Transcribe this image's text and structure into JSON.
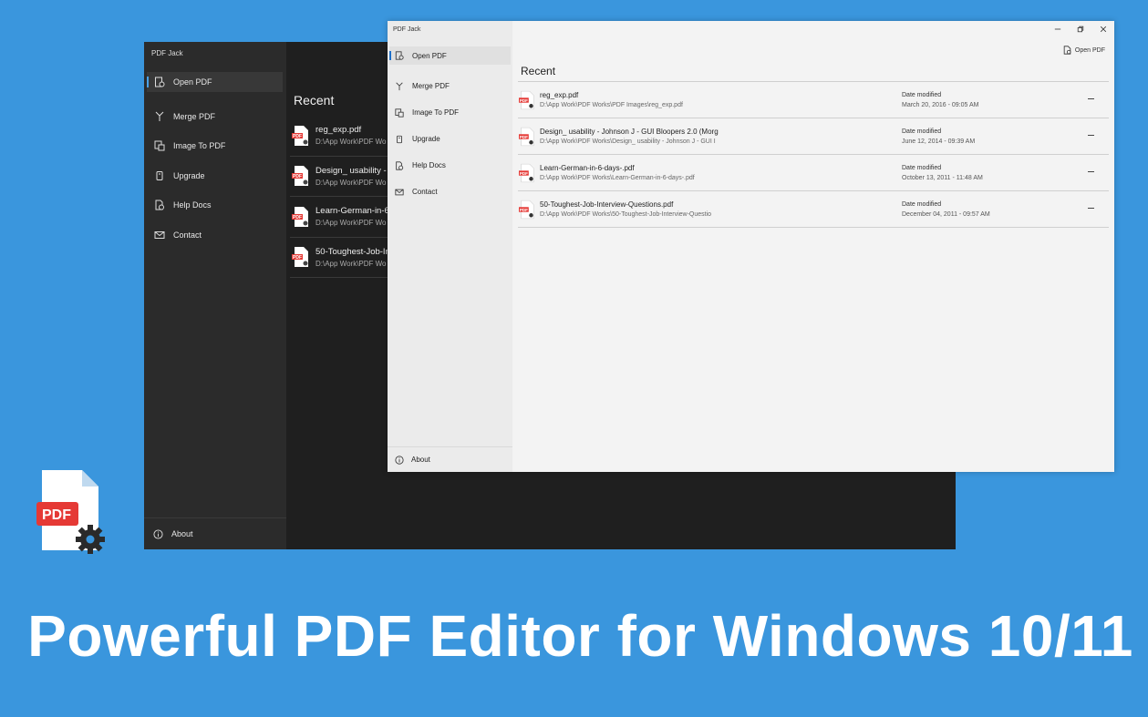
{
  "headline": "Powerful PDF Editor for Windows 10/11",
  "colors": {
    "background": "#3a96dd",
    "accent": "#1d6fc9",
    "pdf_red": "#e53935"
  },
  "dark_window": {
    "title": "PDF Jack",
    "nav": [
      {
        "label": "Open PDF",
        "icon": "open-pdf-icon"
      },
      {
        "label": "Merge PDF",
        "icon": "merge-icon"
      },
      {
        "label": "Image To PDF",
        "icon": "image-icon"
      },
      {
        "label": "Upgrade",
        "icon": "upgrade-icon"
      },
      {
        "label": "Help Docs",
        "icon": "help-docs-icon"
      },
      {
        "label": "Contact",
        "icon": "mail-icon"
      }
    ],
    "about_label": "About",
    "recent_title": "Recent",
    "files": [
      {
        "name": "reg_exp.pdf",
        "path": "D:\\App Work\\PDF Wo"
      },
      {
        "name": "Design_ usability - J",
        "path": "D:\\App Work\\PDF Wo"
      },
      {
        "name": "Learn-German-in-6",
        "path": "D:\\App Work\\PDF Wo"
      },
      {
        "name": "50-Toughest-Job-In",
        "path": "D:\\App Work\\PDF Wo"
      }
    ]
  },
  "light_window": {
    "title": "PDF Jack",
    "nav": [
      {
        "label": "Open PDF",
        "icon": "open-pdf-icon"
      },
      {
        "label": "Merge PDF",
        "icon": "merge-icon"
      },
      {
        "label": "Image To PDF",
        "icon": "image-icon"
      },
      {
        "label": "Upgrade",
        "icon": "upgrade-icon"
      },
      {
        "label": "Help Docs",
        "icon": "help-docs-icon"
      },
      {
        "label": "Contact",
        "icon": "mail-icon"
      }
    ],
    "about_label": "About",
    "open_pdf_button": "Open PDF",
    "recent_title": "Recent",
    "files": [
      {
        "name": "reg_exp.pdf",
        "path": "D:\\App Work\\PDF Works\\PDF Images\\reg_exp.pdf",
        "date_label": "Date modified",
        "date": "March 20, 2016 - 09:05 AM"
      },
      {
        "name": "Design_ usability - Johnson J - GUI Bloopers 2.0 (Morg",
        "path": "D:\\App Work\\PDF Works\\Design_ usability - Johnson J - GUI I",
        "date_label": "Date modified",
        "date": "June 12, 2014 - 09:39 AM"
      },
      {
        "name": "Learn-German-in-6-days-.pdf",
        "path": "D:\\App Work\\PDF Works\\Learn-German-in-6-days-.pdf",
        "date_label": "Date modified",
        "date": "October 13, 2011 - 11:48 AM"
      },
      {
        "name": "50-Toughest-Job-Interview-Questions.pdf",
        "path": "D:\\App Work\\PDF Works\\50-Toughest-Job-Interview-Questio",
        "date_label": "Date modified",
        "date": "December 04, 2011 - 09:57 AM"
      }
    ]
  },
  "logo_text": "PDF"
}
